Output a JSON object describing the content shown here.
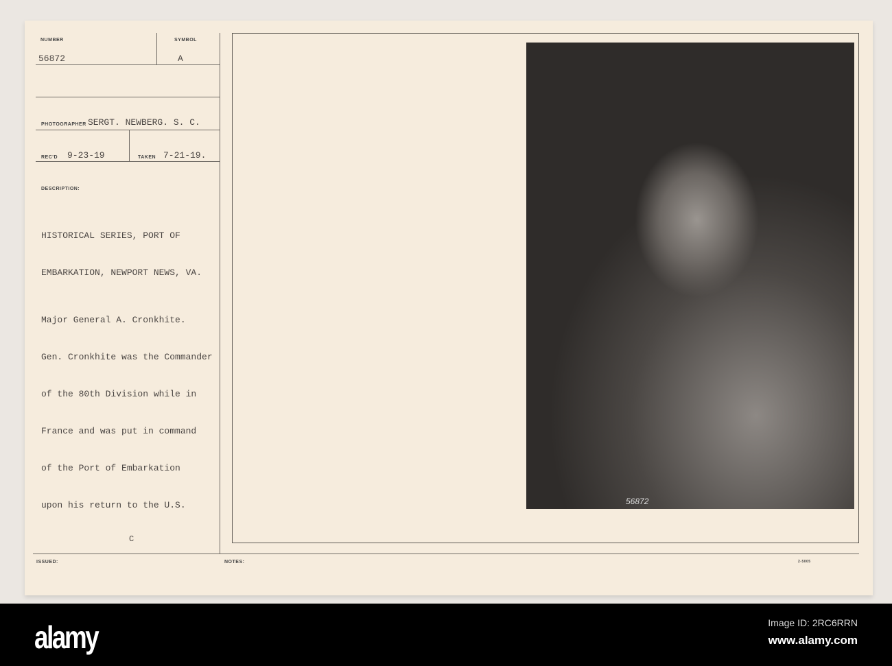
{
  "card": {
    "number_label": "NUMBER",
    "number": "56872",
    "symbol_label": "SYMBOL",
    "symbol": "A",
    "photographer_label": "PHOTOGRAPHER",
    "photographer": "SERGT. NEWBERG. S. C.",
    "recd_label": "REC'D",
    "recd": "9-23-19",
    "taken_label": "TAKEN",
    "taken": "7-21-19.",
    "description_label": "DESCRIPTION:",
    "description_lines": [
      "HISTORICAL SERIES, PORT OF",
      "EMBARKATION, NEWPORT NEWS, VA."
    ],
    "caption_lines": [
      "Major General A. Cronkhite.",
      "Gen. Cronkhite was the Commander",
      "of the 80th Division while in",
      "France and was put in command",
      "of the Port of Embarkation",
      "upon his return to the U.S."
    ],
    "mark_c": "C",
    "issued_label": "ISSUED:",
    "notes_label": "NOTES:",
    "form_number": "2-5005",
    "photo_number": "56872"
  },
  "footer": {
    "logo": "alamy",
    "image_id": "Image ID: 2RC6RRN",
    "site": "www.alamy.com"
  }
}
